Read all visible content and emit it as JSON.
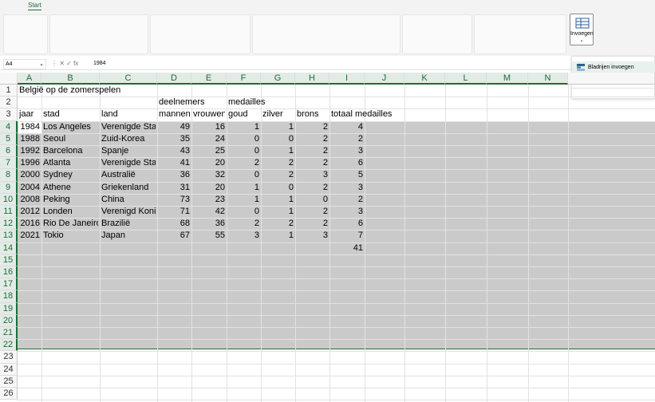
{
  "ribbon": {
    "tab_start": "Start",
    "insert_label": "Invoegen",
    "insert_caret": "⌄"
  },
  "formula": {
    "namebox": "A4",
    "namebox_caret": "⌄",
    "fx_icons": "⋮  ✕  ✓  fx",
    "value": "1984"
  },
  "dropdown": {
    "item": "Bladrijen invoegen"
  },
  "columns": [
    "A",
    "B",
    "C",
    "D",
    "E",
    "F",
    "G",
    "H",
    "I",
    "J",
    "K",
    "L",
    "M",
    "N"
  ],
  "rows": [
    "1",
    "2",
    "3",
    "4",
    "5",
    "6",
    "7",
    "8",
    "9",
    "10",
    "11",
    "12",
    "13",
    "14",
    "15",
    "16",
    "17",
    "18",
    "19",
    "20",
    "21",
    "22",
    "23",
    "24",
    "25",
    "26"
  ],
  "sheet": {
    "title": "België op de zomerspelen",
    "hdr_deelnemers": "deelnemers",
    "hdr_medailles": "medailles",
    "hdr_jaar": "jaar",
    "hdr_stad": "stad",
    "hdr_land": "land",
    "hdr_mannen": "mannen",
    "hdr_vrouwen": "vrouwen",
    "hdr_goud": "goud",
    "hdr_zilver": "zilver",
    "hdr_brons": "brons",
    "hdr_totaal": "totaal medailles",
    "total": "41"
  },
  "table": [
    [
      "1984",
      "Los Angeles",
      "Verenigde Staten",
      "49",
      "16",
      "1",
      "1",
      "2",
      "4"
    ],
    [
      "1988",
      "Seoul",
      "Zuid-Korea",
      "35",
      "24",
      "0",
      "0",
      "2",
      "2"
    ],
    [
      "1992",
      "Barcelona",
      "Spanje",
      "43",
      "25",
      "0",
      "1",
      "2",
      "3"
    ],
    [
      "1996",
      "Atlanta",
      "Verenigde Staten",
      "41",
      "20",
      "2",
      "2",
      "2",
      "6"
    ],
    [
      "2000",
      "Sydney",
      "Australië",
      "36",
      "32",
      "0",
      "2",
      "3",
      "5"
    ],
    [
      "2004",
      "Athene",
      "Griekenland",
      "31",
      "20",
      "1",
      "0",
      "2",
      "3"
    ],
    [
      "2008",
      "Peking",
      "China",
      "73",
      "23",
      "1",
      "1",
      "0",
      "2"
    ],
    [
      "2012",
      "Londen",
      "Verenigd Koninkrijk",
      "71",
      "42",
      "0",
      "1",
      "2",
      "3"
    ],
    [
      "2016",
      "Rio De Janeiro",
      "Brazilië",
      "68",
      "36",
      "2",
      "2",
      "2",
      "6"
    ],
    [
      "2021",
      "Tokio",
      "Japan",
      "67",
      "55",
      "3",
      "1",
      "3",
      "7"
    ]
  ],
  "colors": {
    "accent": "#1e6b3a",
    "selection": "#cacaca"
  }
}
